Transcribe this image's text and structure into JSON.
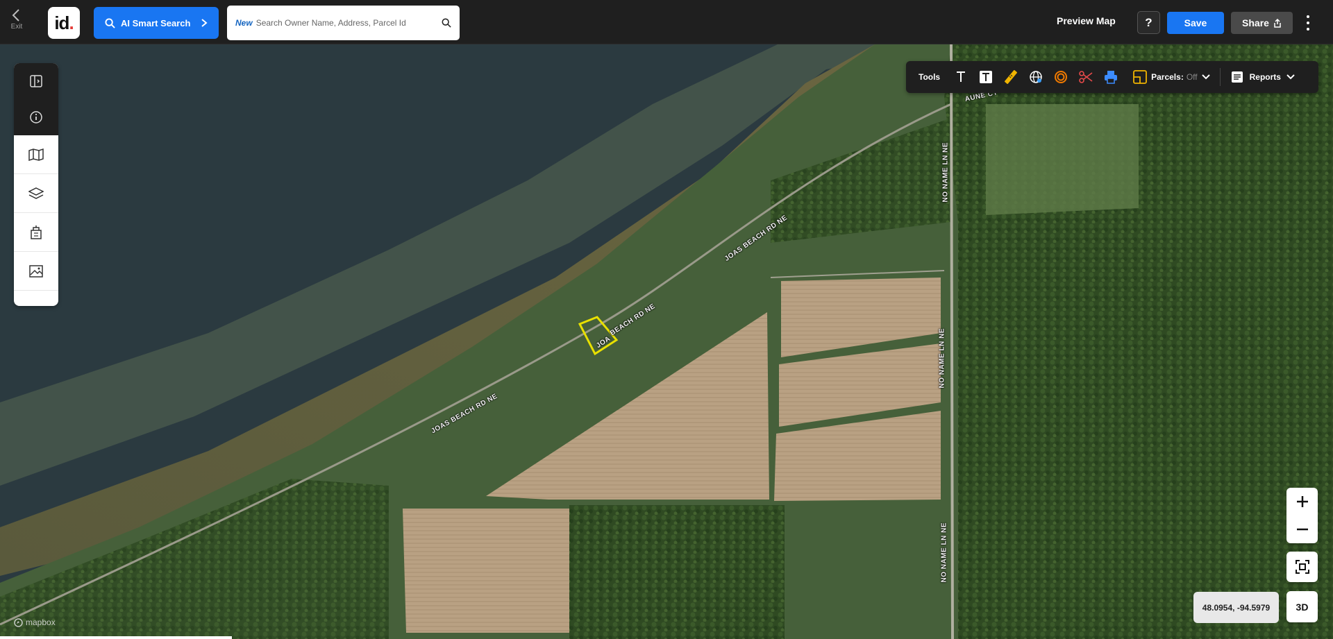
{
  "header": {
    "exit_label": "Exit",
    "logo_text": "id",
    "ai_search_label": "AI Smart Search",
    "search": {
      "badge": "New",
      "placeholder": "Search Owner Name, Address, Parcel Id"
    },
    "preview_label": "Preview Map",
    "help_label": "?",
    "save_label": "Save",
    "share_label": "Share"
  },
  "sidebar": {
    "items": [
      {
        "icon": "panel-toggle-icon"
      },
      {
        "icon": "info-icon"
      },
      {
        "icon": "map-icon"
      },
      {
        "icon": "layers-icon"
      },
      {
        "icon": "buildings-icon"
      },
      {
        "icon": "image-icon"
      }
    ]
  },
  "tools": {
    "label": "Tools",
    "items": [
      "text-icon",
      "text-box-icon",
      "ruler-icon",
      "globe-icon",
      "radius-icon",
      "scissors-icon",
      "print-icon"
    ],
    "parcels_label": "Parcels:",
    "parcels_state": "Off",
    "reports_label": "Reports"
  },
  "map": {
    "road_labels": {
      "joas_1": "JOAS BEACH RD NE",
      "joas_2": "JOAS BEACH RD NE",
      "joas_3": "BEACH RD NE",
      "joa_parcel": "JOA",
      "noname_1": "NO NAME LN NE",
      "noname_2": "NO NAME LN NE",
      "noname_3": "NO NAME LN NE",
      "aune": "AUNE CT"
    },
    "coordinates": "48.0954, -94.5979",
    "three_d_label": "3D",
    "attribution": "mapbox"
  },
  "colors": {
    "accent": "#1976f2",
    "parcel_outline": "#e8e000",
    "toolbar_bg": "#1f1f1f"
  }
}
